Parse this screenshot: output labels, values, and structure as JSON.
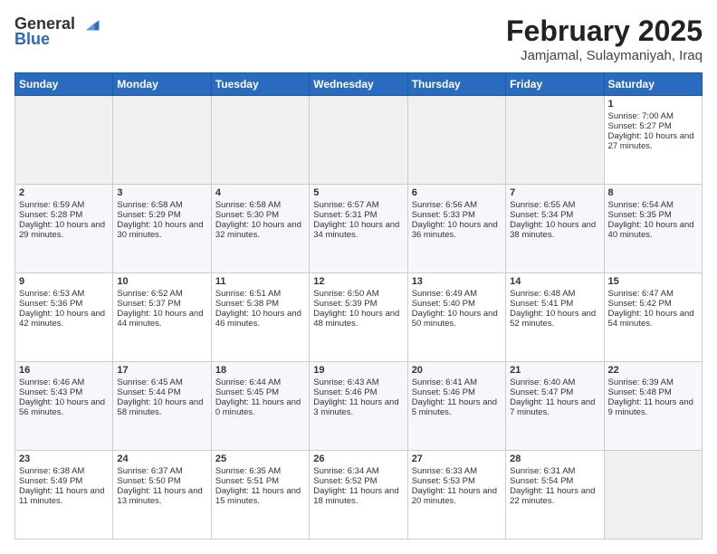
{
  "logo": {
    "general": "General",
    "blue": "Blue"
  },
  "header": {
    "month": "February 2025",
    "location": "Jamjamal, Sulaymaniyah, Iraq"
  },
  "weekdays": [
    "Sunday",
    "Monday",
    "Tuesday",
    "Wednesday",
    "Thursday",
    "Friday",
    "Saturday"
  ],
  "weeks": [
    [
      {
        "day": "",
        "info": ""
      },
      {
        "day": "",
        "info": ""
      },
      {
        "day": "",
        "info": ""
      },
      {
        "day": "",
        "info": ""
      },
      {
        "day": "",
        "info": ""
      },
      {
        "day": "",
        "info": ""
      },
      {
        "day": "1",
        "info": "Sunrise: 7:00 AM\nSunset: 5:27 PM\nDaylight: 10 hours and 27 minutes."
      }
    ],
    [
      {
        "day": "2",
        "info": "Sunrise: 6:59 AM\nSunset: 5:28 PM\nDaylight: 10 hours and 29 minutes."
      },
      {
        "day": "3",
        "info": "Sunrise: 6:58 AM\nSunset: 5:29 PM\nDaylight: 10 hours and 30 minutes."
      },
      {
        "day": "4",
        "info": "Sunrise: 6:58 AM\nSunset: 5:30 PM\nDaylight: 10 hours and 32 minutes."
      },
      {
        "day": "5",
        "info": "Sunrise: 6:57 AM\nSunset: 5:31 PM\nDaylight: 10 hours and 34 minutes."
      },
      {
        "day": "6",
        "info": "Sunrise: 6:56 AM\nSunset: 5:33 PM\nDaylight: 10 hours and 36 minutes."
      },
      {
        "day": "7",
        "info": "Sunrise: 6:55 AM\nSunset: 5:34 PM\nDaylight: 10 hours and 38 minutes."
      },
      {
        "day": "8",
        "info": "Sunrise: 6:54 AM\nSunset: 5:35 PM\nDaylight: 10 hours and 40 minutes."
      }
    ],
    [
      {
        "day": "9",
        "info": "Sunrise: 6:53 AM\nSunset: 5:36 PM\nDaylight: 10 hours and 42 minutes."
      },
      {
        "day": "10",
        "info": "Sunrise: 6:52 AM\nSunset: 5:37 PM\nDaylight: 10 hours and 44 minutes."
      },
      {
        "day": "11",
        "info": "Sunrise: 6:51 AM\nSunset: 5:38 PM\nDaylight: 10 hours and 46 minutes."
      },
      {
        "day": "12",
        "info": "Sunrise: 6:50 AM\nSunset: 5:39 PM\nDaylight: 10 hours and 48 minutes."
      },
      {
        "day": "13",
        "info": "Sunrise: 6:49 AM\nSunset: 5:40 PM\nDaylight: 10 hours and 50 minutes."
      },
      {
        "day": "14",
        "info": "Sunrise: 6:48 AM\nSunset: 5:41 PM\nDaylight: 10 hours and 52 minutes."
      },
      {
        "day": "15",
        "info": "Sunrise: 6:47 AM\nSunset: 5:42 PM\nDaylight: 10 hours and 54 minutes."
      }
    ],
    [
      {
        "day": "16",
        "info": "Sunrise: 6:46 AM\nSunset: 5:43 PM\nDaylight: 10 hours and 56 minutes."
      },
      {
        "day": "17",
        "info": "Sunrise: 6:45 AM\nSunset: 5:44 PM\nDaylight: 10 hours and 58 minutes."
      },
      {
        "day": "18",
        "info": "Sunrise: 6:44 AM\nSunset: 5:45 PM\nDaylight: 11 hours and 0 minutes."
      },
      {
        "day": "19",
        "info": "Sunrise: 6:43 AM\nSunset: 5:46 PM\nDaylight: 11 hours and 3 minutes."
      },
      {
        "day": "20",
        "info": "Sunrise: 6:41 AM\nSunset: 5:46 PM\nDaylight: 11 hours and 5 minutes."
      },
      {
        "day": "21",
        "info": "Sunrise: 6:40 AM\nSunset: 5:47 PM\nDaylight: 11 hours and 7 minutes."
      },
      {
        "day": "22",
        "info": "Sunrise: 6:39 AM\nSunset: 5:48 PM\nDaylight: 11 hours and 9 minutes."
      }
    ],
    [
      {
        "day": "23",
        "info": "Sunrise: 6:38 AM\nSunset: 5:49 PM\nDaylight: 11 hours and 11 minutes."
      },
      {
        "day": "24",
        "info": "Sunrise: 6:37 AM\nSunset: 5:50 PM\nDaylight: 11 hours and 13 minutes."
      },
      {
        "day": "25",
        "info": "Sunrise: 6:35 AM\nSunset: 5:51 PM\nDaylight: 11 hours and 15 minutes."
      },
      {
        "day": "26",
        "info": "Sunrise: 6:34 AM\nSunset: 5:52 PM\nDaylight: 11 hours and 18 minutes."
      },
      {
        "day": "27",
        "info": "Sunrise: 6:33 AM\nSunset: 5:53 PM\nDaylight: 11 hours and 20 minutes."
      },
      {
        "day": "28",
        "info": "Sunrise: 6:31 AM\nSunset: 5:54 PM\nDaylight: 11 hours and 22 minutes."
      },
      {
        "day": "",
        "info": ""
      }
    ]
  ]
}
